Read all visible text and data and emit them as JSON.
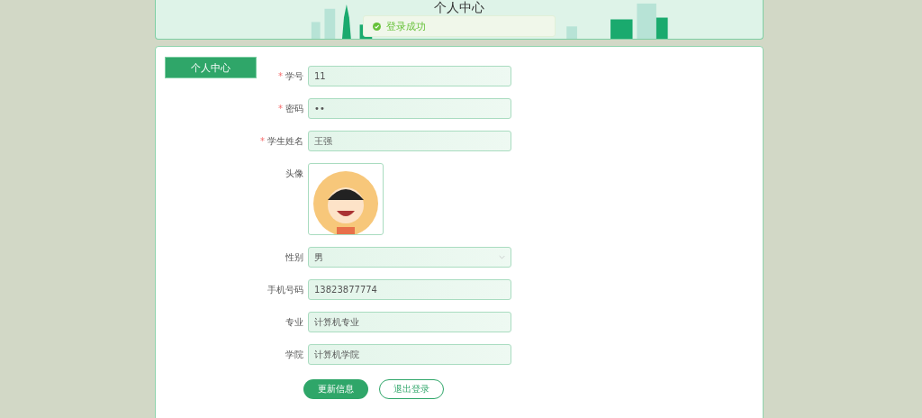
{
  "header": {
    "title": "个人中心"
  },
  "toast": {
    "message": "登录成功"
  },
  "sidebar": {
    "items": [
      {
        "label": "个人中心",
        "selected": true
      }
    ]
  },
  "form": {
    "required_mark": "*",
    "fields": [
      {
        "kind": "text",
        "label": "学号",
        "required": true,
        "value": "11"
      },
      {
        "kind": "text",
        "label": "密码",
        "required": true,
        "value": "••"
      },
      {
        "kind": "text",
        "label": "学生姓名",
        "required": true,
        "value": "王强"
      },
      {
        "kind": "image",
        "label": "头像",
        "required": false
      },
      {
        "kind": "select",
        "label": "性别",
        "required": false,
        "value": "男"
      },
      {
        "kind": "text",
        "label": "手机号码",
        "required": false,
        "value": "13823877774"
      },
      {
        "kind": "text",
        "label": "专业",
        "required": false,
        "value": "计算机专业"
      },
      {
        "kind": "text",
        "label": "学院",
        "required": false,
        "value": "计算机学院"
      }
    ]
  },
  "buttons": [
    {
      "kind": "primary",
      "label": "更新信息"
    },
    {
      "kind": "outline",
      "label": "退出登录"
    }
  ]
}
